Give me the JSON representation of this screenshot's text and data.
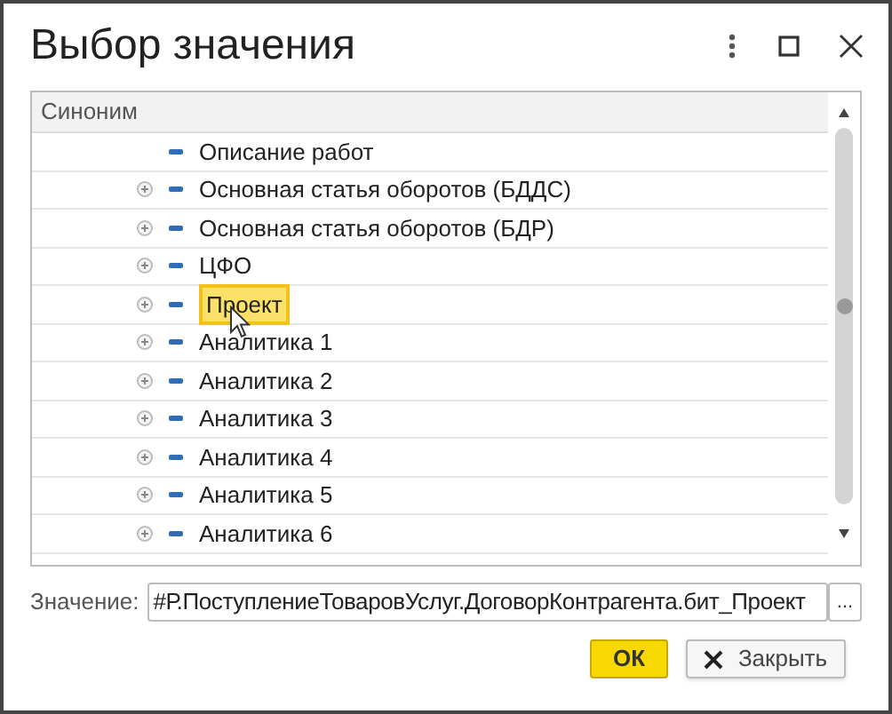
{
  "window": {
    "title": "Выбор значения"
  },
  "table": {
    "columns": [
      "Синоним"
    ],
    "rows": [
      {
        "label": "Описание работ",
        "expandable": false,
        "selected": false
      },
      {
        "label": "Основная статья оборотов (БДДС)",
        "expandable": true,
        "selected": false
      },
      {
        "label": "Основная статья оборотов (БДР)",
        "expandable": true,
        "selected": false
      },
      {
        "label": "ЦФО",
        "expandable": true,
        "selected": false
      },
      {
        "label": "Проект",
        "expandable": true,
        "selected": true
      },
      {
        "label": "Аналитика 1",
        "expandable": true,
        "selected": false
      },
      {
        "label": "Аналитика 2",
        "expandable": true,
        "selected": false
      },
      {
        "label": "Аналитика 3",
        "expandable": true,
        "selected": false
      },
      {
        "label": "Аналитика 4",
        "expandable": true,
        "selected": false
      },
      {
        "label": "Аналитика 5",
        "expandable": true,
        "selected": false
      },
      {
        "label": "Аналитика 6",
        "expandable": true,
        "selected": false
      }
    ]
  },
  "value_field": {
    "label": "Значение:",
    "value": "#Р.ПоступлениеТоваровУслуг.ДоговорКонтрагента.бит_Проект",
    "button": "..."
  },
  "buttons": [
    {
      "label": "ОК",
      "kind": "primary"
    },
    {
      "label": "Закрыть",
      "kind": "close"
    }
  ]
}
